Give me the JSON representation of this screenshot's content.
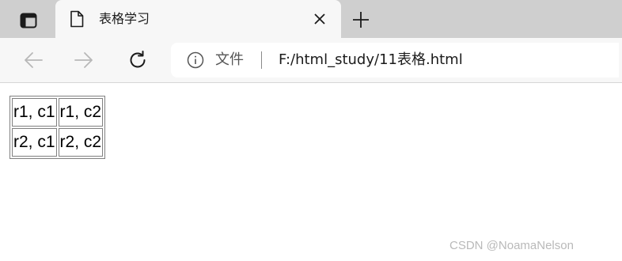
{
  "browser": {
    "tab": {
      "title": "表格学习"
    },
    "address_bar": {
      "site_label": "文件",
      "url": "F:/html_study/11表格.html"
    },
    "icons": {
      "tab_actions": "tab-actions-icon",
      "page": "page-icon",
      "close": "close-icon",
      "new_tab": "plus-icon",
      "back": "arrow-left-icon",
      "forward": "arrow-right-icon",
      "refresh": "refresh-icon",
      "info": "info-icon"
    }
  },
  "page": {
    "table": {
      "rows": [
        [
          "r1, c1",
          "r1, c2"
        ],
        [
          "r2, c1",
          "r2, c2"
        ]
      ]
    },
    "watermark": "CSDN @NoamaNelson"
  }
}
